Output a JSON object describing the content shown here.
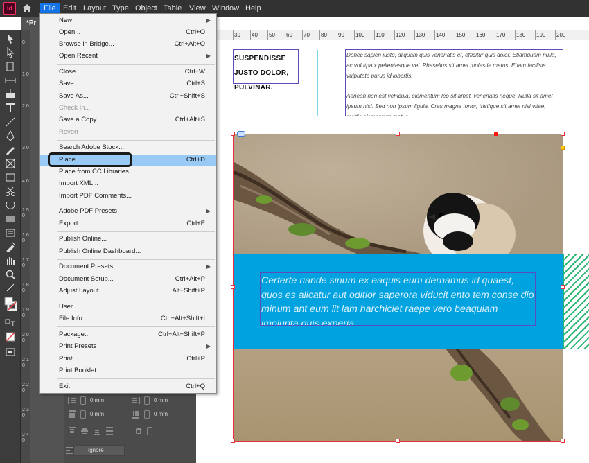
{
  "app": {
    "logo": "Id"
  },
  "menubar": {
    "items": [
      "File",
      "Edit",
      "Layout",
      "Type",
      "Object",
      "Table",
      "View",
      "Window",
      "Help"
    ],
    "active": "File"
  },
  "document": {
    "tab_title": "*Pr"
  },
  "file_menu": {
    "items": [
      {
        "label": "New",
        "shortcut": "",
        "submenu": true,
        "disabled": false
      },
      {
        "label": "Open...",
        "shortcut": "Ctrl+O",
        "disabled": false
      },
      {
        "label": "Browse in Bridge...",
        "shortcut": "Ctrl+Alt+O",
        "disabled": false
      },
      {
        "label": "Open Recent",
        "shortcut": "",
        "submenu": true,
        "disabled": false
      },
      {
        "label": "Close",
        "shortcut": "Ctrl+W",
        "disabled": false
      },
      {
        "label": "Save",
        "shortcut": "Ctrl+S",
        "disabled": false
      },
      {
        "label": "Save As...",
        "shortcut": "Ctrl+Shift+S",
        "disabled": false
      },
      {
        "label": "Check In...",
        "shortcut": "",
        "disabled": true
      },
      {
        "label": "Save a Copy...",
        "shortcut": "Ctrl+Alt+S",
        "disabled": false
      },
      {
        "label": "Revert",
        "shortcut": "",
        "disabled": true
      },
      {
        "label": "Search Adobe Stock...",
        "shortcut": "",
        "disabled": false
      },
      {
        "label": "Place...",
        "shortcut": "Ctrl+D",
        "disabled": false,
        "highlighted": true
      },
      {
        "label": "Place from CC Libraries...",
        "shortcut": "",
        "disabled": false
      },
      {
        "label": "Import XML...",
        "shortcut": "",
        "disabled": false
      },
      {
        "label": "Import PDF Comments...",
        "shortcut": "",
        "disabled": false
      },
      {
        "label": "Adobe PDF Presets",
        "shortcut": "",
        "submenu": true,
        "disabled": false
      },
      {
        "label": "Export...",
        "shortcut": "Ctrl+E",
        "disabled": false
      },
      {
        "label": "Publish Online...",
        "shortcut": "",
        "disabled": false
      },
      {
        "label": "Publish Online Dashboard...",
        "shortcut": "",
        "disabled": false
      },
      {
        "label": "Document Presets",
        "shortcut": "",
        "submenu": true,
        "disabled": false
      },
      {
        "label": "Document Setup...",
        "shortcut": "Ctrl+Alt+P",
        "disabled": false
      },
      {
        "label": "Adjust Layout...",
        "shortcut": "Alt+Shift+P",
        "disabled": false
      },
      {
        "label": "User...",
        "shortcut": "",
        "disabled": false
      },
      {
        "label": "File Info...",
        "shortcut": "Ctrl+Alt+Shift+I",
        "disabled": false
      },
      {
        "label": "Package...",
        "shortcut": "Ctrl+Alt+Shift+P",
        "disabled": false
      },
      {
        "label": "Print Presets",
        "shortcut": "",
        "submenu": true,
        "disabled": false
      },
      {
        "label": "Print...",
        "shortcut": "Ctrl+P",
        "disabled": false
      },
      {
        "label": "Print Booklet...",
        "shortcut": "",
        "disabled": false
      },
      {
        "label": "Exit",
        "shortcut": "Ctrl+Q",
        "disabled": false
      }
    ]
  },
  "hruler": {
    "labels": [
      "30",
      "40",
      "50",
      "60",
      "70",
      "80",
      "90",
      "100",
      "110",
      "120",
      "130",
      "140",
      "150",
      "160",
      "170",
      "180",
      "190",
      "200"
    ]
  },
  "vruler": {
    "labels": [
      "0",
      "1 0",
      "2 0",
      "3 0",
      "4 0",
      "1 5 0",
      "1 6 0",
      "1 7 0",
      "1 8 0",
      "1 9 0",
      "2 0 0",
      "2 1 0",
      "2 2 0",
      "2 3 0",
      "2 4 0",
      "2 5 0",
      "2 6 0",
      "2 7 0"
    ]
  },
  "properties": {
    "values": [
      "0 mm",
      "0 mm",
      "0 mm",
      "0 mm"
    ],
    "ignore": "Ignore"
  },
  "layout": {
    "headline": [
      "SUSPENDISSE",
      "JUSTO DOLOR,",
      "PULVINAR."
    ],
    "body_paragraphs": [
      "Donec sapien justo, aliquam quis venenatis et, efficitur quis dolor. Etiamquam nulla, ac volutpatx pellentesque vel. Phasellus sit amet molestie metus. Etiam facilisis vulputate purus id lobortis.",
      "Aenean non est vehicula, elementum leo sit amet, venenatis neque. Nulla sit amet ipsum nisl. Sed non ipsum ligula. Cras magna tortor, tristique sit amet nisi vitae, mattis elementum metus."
    ],
    "band_text": "Cerferfe riande sinum ex eaquis eum dernamus id quaest, quos es alicatur aut oditior saperora viducit ento tem conse dio minum ant eum lit lam harchiciet raepe vero beaquiam imolupta quis experia"
  },
  "colors": {
    "menubar": "#323232",
    "menu_highlight": "#99c9f5",
    "cyan_band": "#00a3e0",
    "frame_border": "#e8303a",
    "hatch": "#2bb673"
  }
}
